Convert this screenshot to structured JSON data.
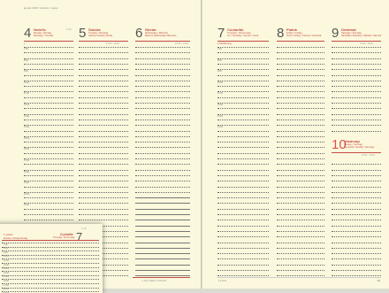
{
  "left": {
    "header": "január 2026 / február / marec",
    "days": [
      {
        "num": "4",
        "name": "Nedeľa",
        "sub": "Monday / Montag",
        "sub2": "Dienstag / Tuesday",
        "right": "2. týž."
      },
      {
        "num": "5",
        "name": "Sobota",
        "sub": "Tuesday / Dienstag",
        "sub2": "Sobota Tuesday Streda",
        "right": ""
      },
      {
        "num": "6",
        "name": "Streda",
        "sub": "Wednesday / Mittwoch",
        "sub2": "Miercuri Wednesday Miércoles",
        "right": ""
      }
    ],
    "sun_left": "●",
    "sun_right_1": "07:53 ◐ 16:18",
    "sun_right_2": "07:53 ◐ 16:18",
    "hours": [
      "7:00",
      "",
      "8:00",
      "",
      "9:00",
      "",
      "10:00",
      "",
      "11:00",
      "",
      "12:00",
      "",
      "13:00",
      "",
      "14:00",
      "",
      "15:00",
      "",
      "16:00",
      "",
      "17:00",
      "",
      "18:00",
      "",
      "19:00",
      "",
      "20:00",
      "",
      "21:00"
    ],
    "footer": "1. ATÉ LAREN / SAS/VGR"
  },
  "right": {
    "days": [
      {
        "num": "7",
        "name": "Cuoiaribk",
        "sub": "Thursday / Donnerstag",
        "sub2": "Joi / Thursday / Jueves / Jeudi",
        "right": ""
      },
      {
        "num": "8",
        "name": "Piatok",
        "sub": "Friday / Freitag",
        "sub2": "Vineri / Friday / Viernes / Vendredi",
        "right": ""
      },
      {
        "num": "9",
        "name": "Dewtmat",
        "sub": "Saturday / Samstag",
        "sub2": "Sâmbătă / Saturday / Sábado / Samedi",
        "right": ""
      }
    ],
    "sun_left": "● Sun/Morning",
    "sun_right": "07:52 ◐ 16:20",
    "hours": [
      "7:00",
      "",
      "8:00",
      "",
      "9:00",
      "",
      "10:00",
      "",
      "11:00",
      "",
      "12:00",
      "",
      "13:00",
      "",
      "14:00",
      "",
      "15:00",
      "",
      "16:00",
      "",
      "17:00",
      "",
      "18:00",
      "",
      "19:00",
      "",
      "20:00",
      "",
      "21:00"
    ],
    "sunday": {
      "num": "10",
      "name": "Vasárnap",
      "sub": "Sunday / Sonntag",
      "sub2": "Duminică / Sunday / Domingo"
    },
    "sunday_sun": "07:51 ◐ 16:21",
    "footer_left": "Tip Bulle",
    "page_number": "28"
  },
  "inset": {
    "day": {
      "num": "7",
      "name": "Cuolatile",
      "sub": "Thursday / Donnerstag"
    },
    "left_label": "5. týždeň",
    "left_sub": "Monday / Montag Sunday",
    "top_right": "2. týž",
    "hours": [
      "7:00",
      "8:00",
      "9:00",
      "10:00",
      "11:00",
      "12:00",
      "13:00",
      "14:00",
      "15:00",
      "16:00",
      "17:00",
      "18:00",
      "19:00"
    ]
  }
}
